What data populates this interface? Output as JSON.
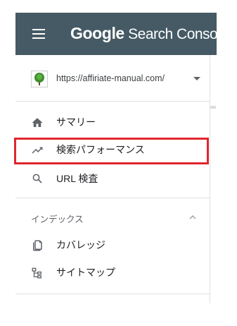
{
  "header": {
    "brand_google": "Google",
    "brand_product": " Search Console"
  },
  "property": {
    "url": "https://affiriate-manual.com/"
  },
  "nav": {
    "items": [
      {
        "label": "サマリー",
        "icon": "home-icon"
      },
      {
        "label": "検索パフォーマンス",
        "icon": "trending-up-icon"
      },
      {
        "label": "URL 検査",
        "icon": "search-icon"
      }
    ]
  },
  "index_section": {
    "title": "インデックス",
    "items": [
      {
        "label": "カバレッジ",
        "icon": "coverage-icon"
      },
      {
        "label": "サイトマップ",
        "icon": "sitemap-icon"
      }
    ]
  },
  "colors": {
    "header_bg": "#455a64",
    "highlight_border": "#e0262f",
    "icon_gray": "#5f6368"
  }
}
